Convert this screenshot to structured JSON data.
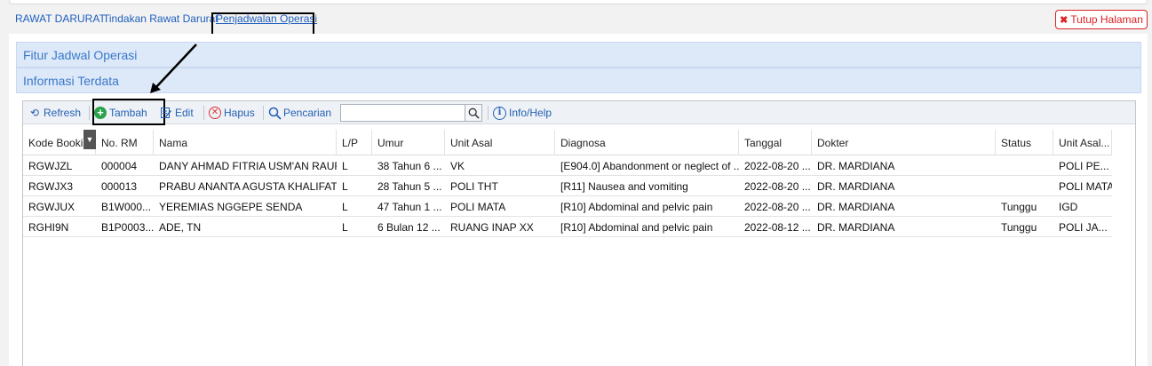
{
  "tabs": [
    "RAWAT DARURAT",
    "Tindakan Rawat Darurat",
    "Penjadwalan Operasi"
  ],
  "close_button": "Tutup Halaman",
  "panels": {
    "feature_title": "Fitur Jadwal Operasi",
    "info_title": "Informasi Terdata"
  },
  "toolbar": {
    "refresh": "Refresh",
    "tambah": "Tambah",
    "edit": "Edit",
    "hapus": "Hapus",
    "pencarian": "Pencarian",
    "search_value": "",
    "info": "Info/Help"
  },
  "table": {
    "columns": [
      "Kode Booking",
      "No. RM",
      "Nama",
      "L/P",
      "Umur",
      "Unit Asal",
      "Diagnosa",
      "Tanggal",
      "Dokter",
      "Status",
      "Unit Asal..."
    ],
    "rows": [
      [
        "RGWJZL",
        "000004",
        "DANY AHMAD FITRIA USM'AN RAUF,...",
        "L",
        "38 Tahun 6 ...",
        "VK",
        "[E904.0] Abandonment or neglect of ...",
        "2022-08-20 ...",
        "DR. MARDIANA",
        "",
        "POLI PE..."
      ],
      [
        "RGWJX3",
        "000013",
        "PRABU ANANTA AGUSTA KHALIFAT...",
        "L",
        "28 Tahun 5 ...",
        "POLI THT",
        "[R11] Nausea and vomiting",
        "2022-08-20 ...",
        "DR. MARDIANA",
        "",
        "POLI MATA"
      ],
      [
        "RGWJUX",
        "B1W000...",
        "YEREMIAS NGGEPE SENDA",
        "L",
        "47 Tahun 1 ...",
        "POLI MATA",
        "[R10] Abdominal and pelvic pain",
        "2022-08-20 ...",
        "DR. MARDIANA",
        "Tunggu",
        "IGD"
      ],
      [
        "RGHI9N",
        "B1P0003...",
        "ADE, TN",
        "L",
        "6 Bulan 12 ...",
        "RUANG INAP XX",
        "[R10] Abdominal and pelvic pain",
        "2022-08-12 ...",
        "DR. MARDIANA",
        "Tunggu",
        "POLI JA..."
      ]
    ]
  },
  "colors": {
    "link": "#1f5fbf",
    "panel_bg": "#dde9f8",
    "panel_text": "#3a78c9",
    "danger": "#dd2222",
    "add": "#2aa24a"
  }
}
